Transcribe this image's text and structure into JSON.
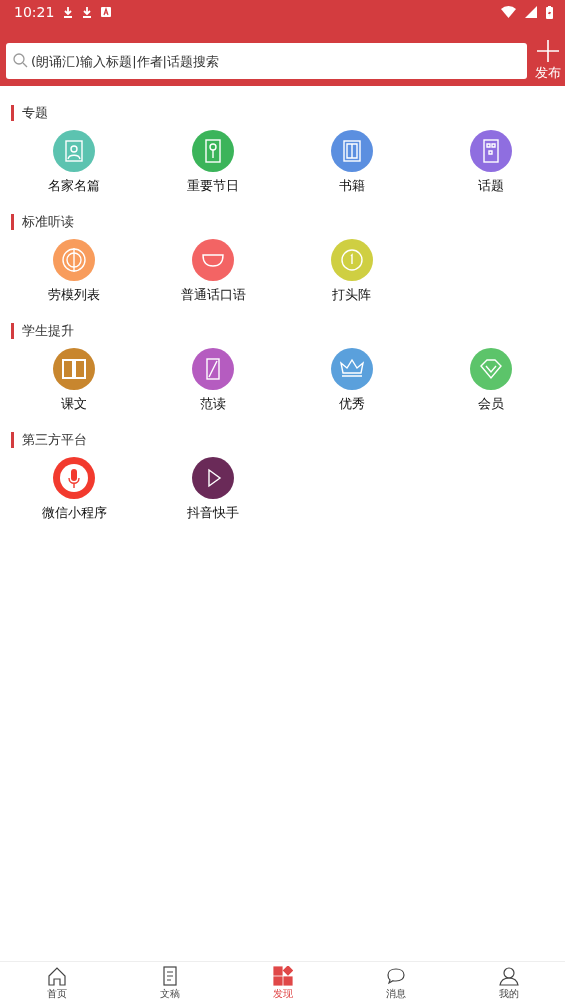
{
  "status_bar": {
    "time": "10:21"
  },
  "search": {
    "placeholder": "(朗诵汇)输入标题|作者|话题搜索"
  },
  "publish_button": {
    "label": "发布"
  },
  "sections": [
    {
      "title": "专题",
      "items": [
        {
          "label": "名家名篇",
          "kind": "portrait",
          "color": "#5cc3b0"
        },
        {
          "label": "重要节日",
          "kind": "tag",
          "color": "#3bb45a"
        },
        {
          "label": "书籍",
          "kind": "book",
          "color": "#5b8fe0"
        },
        {
          "label": "话题",
          "kind": "board",
          "color": "#8f6ee0"
        }
      ]
    },
    {
      "title": "标准听读",
      "items": [
        {
          "label": "劳模列表",
          "kind": "target",
          "color": "#f89c5c"
        },
        {
          "label": "普通话口语",
          "kind": "bowl",
          "color": "#f36464"
        },
        {
          "label": "打头阵",
          "kind": "coin",
          "color": "#cfcf42"
        }
      ]
    },
    {
      "title": "学生提升",
      "items": [
        {
          "label": "课文",
          "kind": "openbook",
          "color": "#c8862e"
        },
        {
          "label": "范读",
          "kind": "slash",
          "color": "#b55cc0"
        },
        {
          "label": "优秀",
          "kind": "crown",
          "color": "#5aa0dc"
        },
        {
          "label": "会员",
          "kind": "diamond",
          "color": "#5cc46a"
        }
      ]
    },
    {
      "title": "第三方平台",
      "items": [
        {
          "label": "微信小程序",
          "kind": "mic",
          "color": "#f23a2e"
        },
        {
          "label": "抖音快手",
          "kind": "play",
          "color": "#6a2a58"
        }
      ]
    }
  ],
  "tabs": [
    {
      "label": "首页",
      "kind": "home",
      "selected": false
    },
    {
      "label": "文稿",
      "kind": "doc",
      "selected": false
    },
    {
      "label": "发现",
      "kind": "grid",
      "selected": true
    },
    {
      "label": "消息",
      "kind": "chat",
      "selected": false
    },
    {
      "label": "我的",
      "kind": "user",
      "selected": false
    }
  ]
}
